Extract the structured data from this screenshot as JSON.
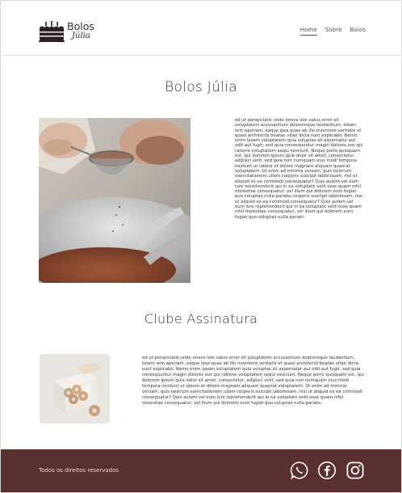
{
  "header": {
    "logo_line1": "Bolos",
    "logo_line2": "Júlia",
    "nav": [
      "Home",
      "Sobre",
      "Bolos"
    ]
  },
  "section1": {
    "title": "Bolos Júlia",
    "paragraph": "ed ut perspiciatis unde omnis iste natus error sit voluptatem accusantium doloremque laudantium, totam rem aperiam, eaque ipsa quae ab illo inventore veritatis et quasi architecto beatae vitae dicta sunt explicabo. Nemo enim ipsam voluptatem quia voluptas sit aspernatur aut odit aut fugit, sed quia consequuntur magni dolores eos qui ratione voluptatem sequi nesciunt. Neque porro quisquam est, qui dolorem ipsum quia dolor sit amet, consectetur, adipisci velit, sed quia non numquam eius modi tempora incidunt ut labore et dolore magnam aliquam quaerat voluptatem. Ut enim ad minima veniam, quis nostrum exercitationem ullam corporis suscipit laboriosam, nisi ut aliquid ex ea commodi consequatur? Quis autem vel eum iure reprehenderit qui in ea voluptate velit esse quam nihil molestiae consequatur, vel illum qui dolorem eum fugiat quo voluptas nulla pariatu corporis suscipit laboriosam, nisi ut aliquid ex ea commodi consequatur? Quis autem vel eum iure reprehenderit qui in ea voluptate velit esse quam nihil molestiae consequatur, vel illum qui dolorem eum fugiat quo voluptas nulla pariatr."
  },
  "section2": {
    "title": "Clube Assinatura",
    "paragraph": "ed ut perspiciatis unde omnis iste natus error sit voluptatem accusantium doloremque laudantium, totam rem aperiam, eaque ipsa quae ab illo inventore veritatis et quasi architecto beatae vitae dicta sunt explicabo. Nemo enim ipsam voluptatem quia voluptas sit aspernatur aut odit aut fugit, sed quia consequuntur magni dolores eos qui ratione voluptatem sequi nesciunt. Neque porro quisquam est, qui dolorem ipsum quia dolor sit amet, consectetur, adipisci velit, sed quia non numquam eius modi tempora incidunt ut labore et dolore magnam aliquam quaerat voluptatem. Ut enim ad minima veniam, quis nostrum exercitationem ullam corporis suscipit laboriosam, nisi ut aliquid ex ea commodi consequatur? Quis autem vel eum iure reprehenderit qui in ea voluptate velit esse quam nihil molestiae consequatur, vel illum qui dolorem eum fugiat quo voluptas nulla pariatu."
  },
  "footer": {
    "copyright": "Todos os direitos reservados",
    "social_icons": [
      "whatsapp-icon",
      "facebook-icon",
      "instagram-icon"
    ]
  },
  "colors": {
    "footer_bg": "#5a2f2f",
    "text": "#333333"
  }
}
